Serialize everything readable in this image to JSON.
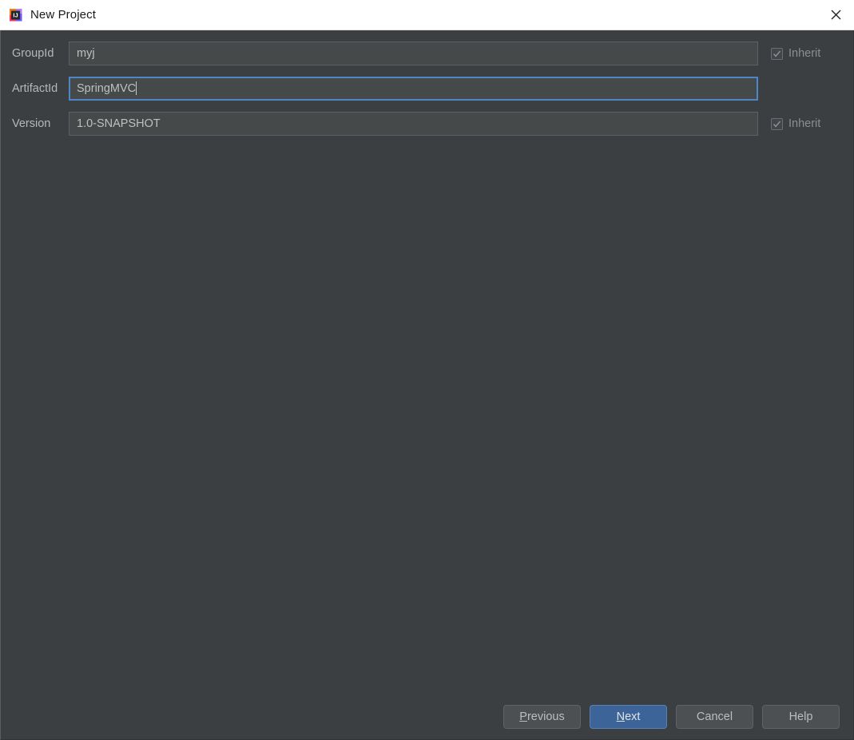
{
  "window": {
    "title": "New Project",
    "app_icon": "intellij-idea-icon",
    "close_icon": "close-icon"
  },
  "form": {
    "rows": [
      {
        "label": "GroupId",
        "value": "myj",
        "placeholder": "",
        "focused": false,
        "inherit": {
          "label": "Inherit",
          "checked": true,
          "disabled": true
        }
      },
      {
        "label": "ArtifactId",
        "value": "SpringMVC",
        "placeholder": "",
        "focused": true,
        "inherit": null
      },
      {
        "label": "Version",
        "value": "1.0-SNAPSHOT",
        "placeholder": "",
        "focused": false,
        "inherit": {
          "label": "Inherit",
          "checked": true,
          "disabled": true
        }
      }
    ]
  },
  "buttons": {
    "previous": {
      "label": "Previous",
      "mnemonic": "P",
      "primary": false
    },
    "next": {
      "label": "Next",
      "mnemonic": "N",
      "primary": true
    },
    "cancel": {
      "label": "Cancel",
      "mnemonic": "",
      "primary": false
    },
    "help": {
      "label": "Help",
      "mnemonic": "",
      "primary": false
    }
  },
  "colors": {
    "titlebar_background": "#ffffff",
    "dialog_background": "#3c3f41",
    "field_background": "#45494a",
    "field_border": "#5d6163",
    "focus_border": "#4d87c7",
    "primary_button": "#3c6498",
    "primary_button_border": "#5781b0",
    "button_background": "#4c5052",
    "text": "#b5b8ba",
    "disabled_text": "#8b8e90"
  }
}
